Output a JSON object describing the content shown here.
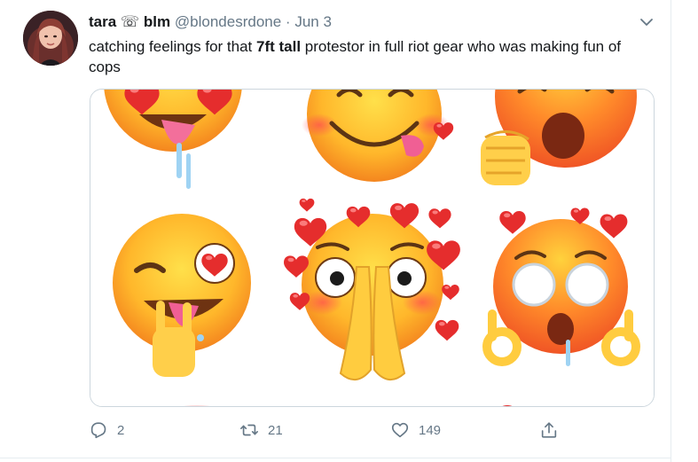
{
  "tweet": {
    "display_name": "tara",
    "name_symbol": "☏",
    "name_suffix": "blm",
    "handle": "@blondesrdone",
    "separator": "·",
    "date": "Jun 3",
    "text_before": "catching feelings for that ",
    "text_bold": "7ft tall",
    "text_after": " protestor in full riot gear who was making fun of cops"
  },
  "actions": {
    "reply_count": "2",
    "retweet_count": "21",
    "like_count": "149"
  },
  "icons": {
    "avatar": "user-avatar",
    "more": "chevron-down-icon",
    "reply": "reply-icon",
    "retweet": "retweet-icon",
    "like": "heart-icon",
    "share": "share-icon"
  },
  "colors": {
    "text": "#14171a",
    "secondary": "#657786",
    "border": "#ccd6dd",
    "emoji_face": "#ffb32e",
    "heart": "#e52d2d"
  }
}
